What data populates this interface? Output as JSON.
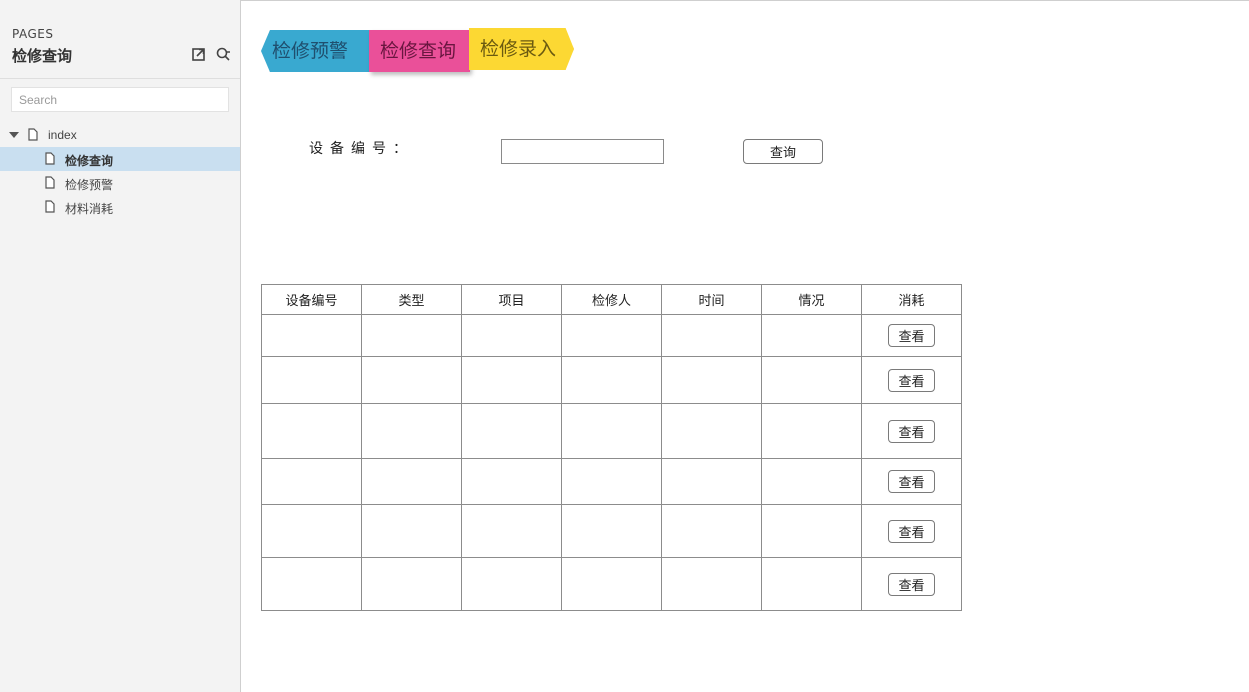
{
  "sidebar": {
    "caption": "PAGES",
    "title": "检修查询",
    "search_placeholder": "Search",
    "tree": {
      "root": "index",
      "items": [
        {
          "label": "检修查询",
          "selected": true
        },
        {
          "label": "检修预警",
          "selected": false
        },
        {
          "label": "材料消耗",
          "selected": false
        }
      ]
    }
  },
  "tabs": {
    "warn": "检修预警",
    "query": "检修查询",
    "entry": "检修录入"
  },
  "colors": {
    "tab_warn": "#39a9d0",
    "tab_query": "#ea5099",
    "tab_entry": "#fcd833",
    "selected_row": "#c9dff0"
  },
  "form": {
    "label": "设备编号：",
    "input_value": "",
    "query_button": "查询"
  },
  "table": {
    "headers": [
      "设备编号",
      "类型",
      "项目",
      "检修人",
      "时间",
      "情况",
      "消耗"
    ],
    "rows": [
      {
        "cells": [
          "",
          "",
          "",
          "",
          "",
          ""
        ],
        "action": "查看"
      },
      {
        "cells": [
          "",
          "",
          "",
          "",
          "",
          ""
        ],
        "action": "查看"
      },
      {
        "cells": [
          "",
          "",
          "",
          "",
          "",
          ""
        ],
        "action": "查看"
      },
      {
        "cells": [
          "",
          "",
          "",
          "",
          "",
          ""
        ],
        "action": "查看"
      },
      {
        "cells": [
          "",
          "",
          "",
          "",
          "",
          ""
        ],
        "action": "查看"
      },
      {
        "cells": [
          "",
          "",
          "",
          "",
          "",
          ""
        ],
        "action": "查看"
      }
    ]
  }
}
